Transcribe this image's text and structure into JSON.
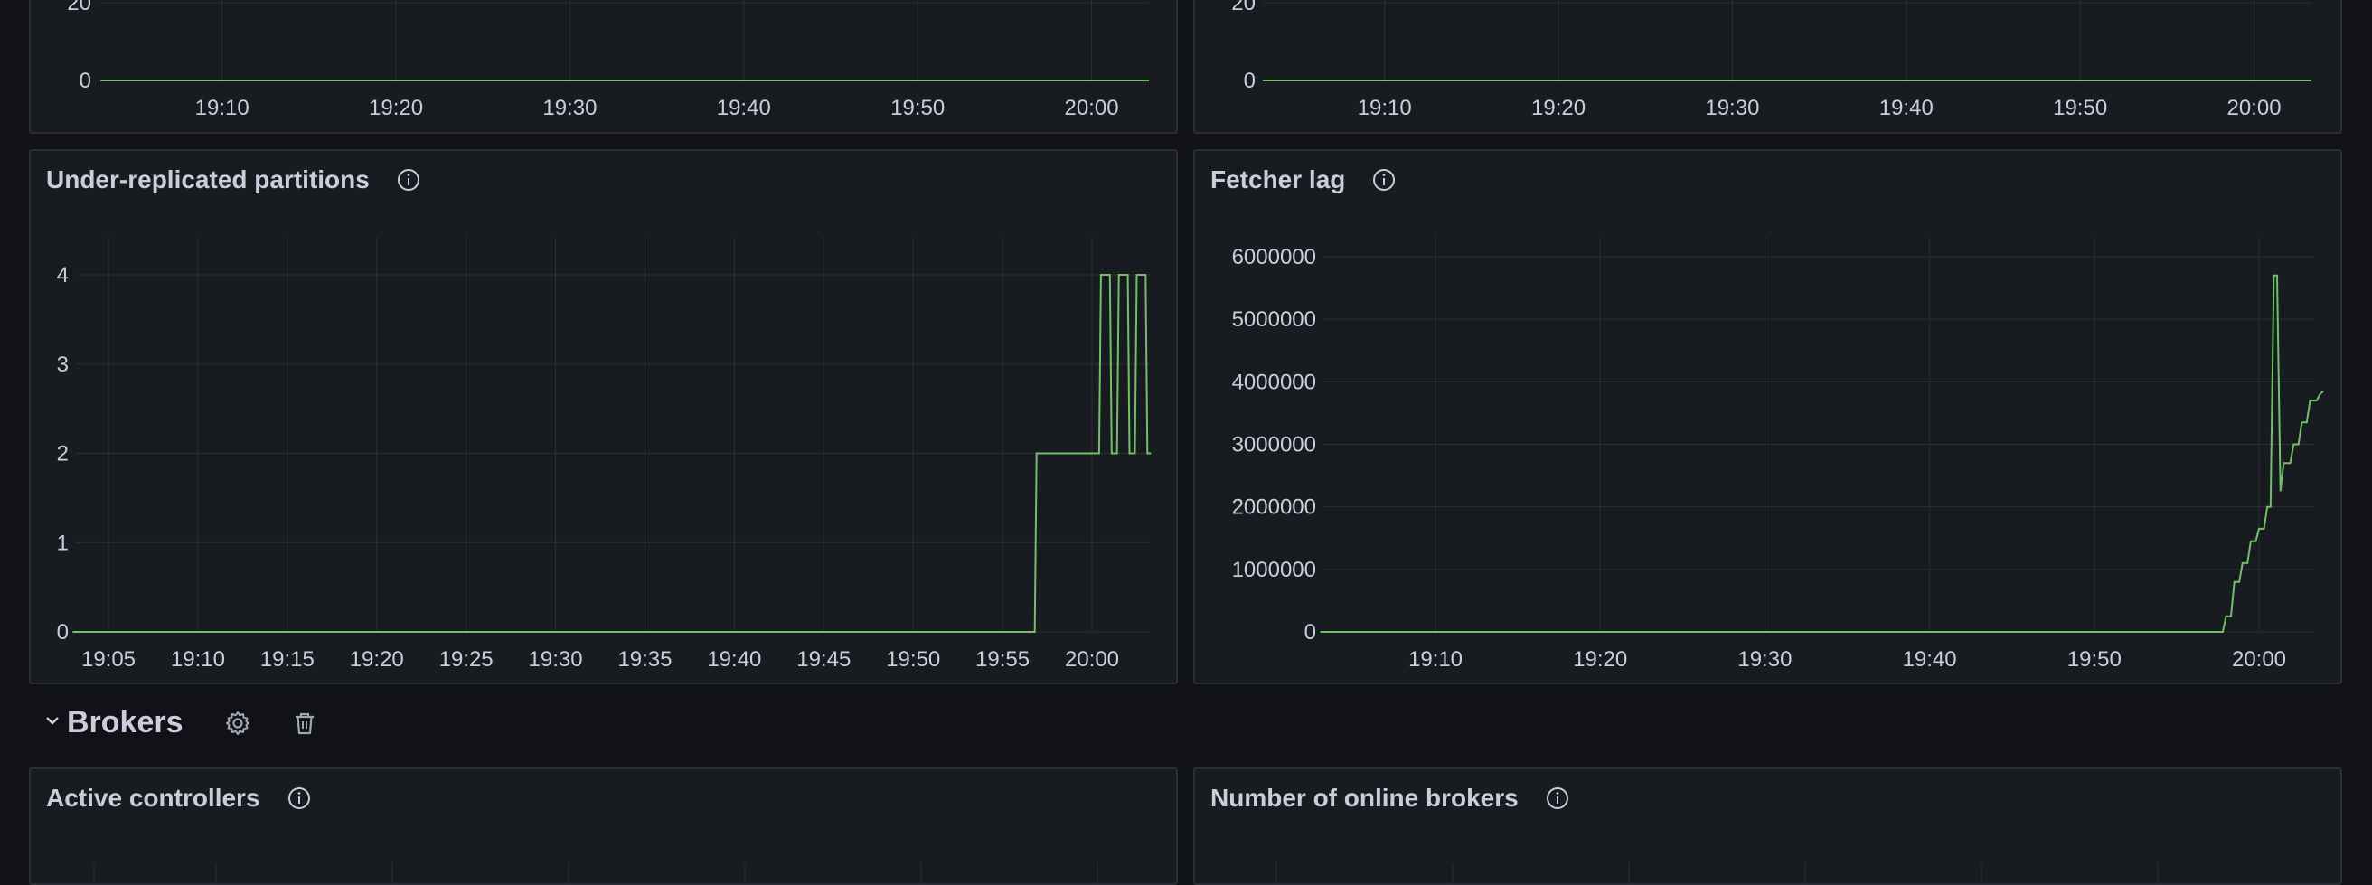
{
  "colors": {
    "background": "#111217",
    "panel_bg": "#181b1f",
    "panel_border": "#2a2d33",
    "grid": "#2c2f35",
    "axis_text": "#ccccdc",
    "series": "#73bf69"
  },
  "top_left_panel": {
    "title": "",
    "chart_data": {
      "type": "line",
      "title": "",
      "x_ticks": [
        "19:10",
        "19:20",
        "19:30",
        "19:40",
        "19:50",
        "20:00"
      ],
      "y_ticks": [
        "20",
        "0"
      ],
      "series": [
        {
          "values": [
            0,
            0
          ]
        }
      ]
    }
  },
  "top_right_panel": {
    "title": "",
    "chart_data": {
      "type": "line",
      "title": "",
      "x_ticks": [
        "19:10",
        "19:20",
        "19:30",
        "19:40",
        "19:50",
        "20:00"
      ],
      "y_ticks": [
        "20",
        "0"
      ],
      "series": [
        {
          "values": [
            0,
            0
          ]
        }
      ]
    }
  },
  "urp_panel": {
    "title": "Under-replicated partitions",
    "info_icon": "info-circle-icon",
    "chart_data": {
      "type": "line",
      "title": "Under-replicated partitions",
      "x": [
        "19:05",
        "19:10",
        "19:15",
        "19:20",
        "19:25",
        "19:30",
        "19:35",
        "19:40",
        "19:45",
        "19:50",
        "19:55",
        "20:00"
      ],
      "x_ticks": [
        "19:05",
        "19:10",
        "19:15",
        "19:20",
        "19:25",
        "19:30",
        "19:35",
        "19:40",
        "19:45",
        "19:50",
        "19:55",
        "20:00"
      ],
      "y_ticks": [
        "0",
        "1",
        "2",
        "3",
        "4"
      ],
      "ylim": [
        0,
        4.4
      ],
      "series": [
        {
          "points": [
            [
              "19:03",
              0
            ],
            [
              "19:56.8",
              0
            ],
            [
              "19:56.9",
              2
            ],
            [
              "20:00.4",
              2
            ],
            [
              "20:00.5",
              4
            ],
            [
              "20:01.0",
              4
            ],
            [
              "20:01.1",
              2
            ],
            [
              "20:01.4",
              2
            ],
            [
              "20:01.5",
              4
            ],
            [
              "20:02.0",
              4
            ],
            [
              "20:02.1",
              2
            ],
            [
              "20:02.4",
              2
            ],
            [
              "20:02.5",
              4
            ],
            [
              "20:03.0",
              4
            ],
            [
              "20:03.1",
              2
            ],
            [
              "20:03.3",
              2
            ]
          ]
        }
      ]
    }
  },
  "fetcher_panel": {
    "title": "Fetcher lag",
    "info_icon": "info-circle-icon",
    "chart_data": {
      "type": "line",
      "title": "Fetcher lag",
      "x_ticks": [
        "19:10",
        "19:20",
        "19:30",
        "19:40",
        "19:50",
        "20:00"
      ],
      "y_ticks": [
        "0",
        "1000000",
        "2000000",
        "3000000",
        "4000000",
        "5000000",
        "6000000"
      ],
      "ylim": [
        0,
        6300000
      ],
      "series": [
        {
          "points": [
            [
              "19:03",
              0
            ],
            [
              "19:57.8",
              0
            ],
            [
              "19:58.0",
              250000
            ],
            [
              "19:58.3",
              250000
            ],
            [
              "19:58.5",
              800000
            ],
            [
              "19:58.8",
              800000
            ],
            [
              "19:59.0",
              1100000
            ],
            [
              "19:59.3",
              1100000
            ],
            [
              "19:59.5",
              1450000
            ],
            [
              "19:59.8",
              1450000
            ],
            [
              "20:00.0",
              1650000
            ],
            [
              "20:00.3",
              1650000
            ],
            [
              "20:00.5",
              2000000
            ],
            [
              "20:00.7",
              2000000
            ],
            [
              "20:00.9",
              5700000
            ],
            [
              "20:01.1",
              5700000
            ],
            [
              "20:01.3",
              2250000
            ],
            [
              "20:01.5",
              2700000
            ],
            [
              "20:01.9",
              2700000
            ],
            [
              "20:02.1",
              3000000
            ],
            [
              "20:02.4",
              3000000
            ],
            [
              "20:02.6",
              3350000
            ],
            [
              "20:02.9",
              3350000
            ],
            [
              "20:03.1",
              3700000
            ],
            [
              "20:03.5",
              3700000
            ],
            [
              "20:03.7",
              3800000
            ],
            [
              "20:03.9",
              3850000
            ]
          ]
        }
      ]
    }
  },
  "brokers_row": {
    "chevron": "chevron-down-icon",
    "title": "Brokers",
    "settings_icon": "gear-icon",
    "delete_icon": "trash-icon"
  },
  "active_controllers_panel": {
    "title": "Active controllers",
    "info_icon": "info-circle-icon"
  },
  "online_brokers_panel": {
    "title": "Number of online brokers",
    "info_icon": "info-circle-icon"
  }
}
